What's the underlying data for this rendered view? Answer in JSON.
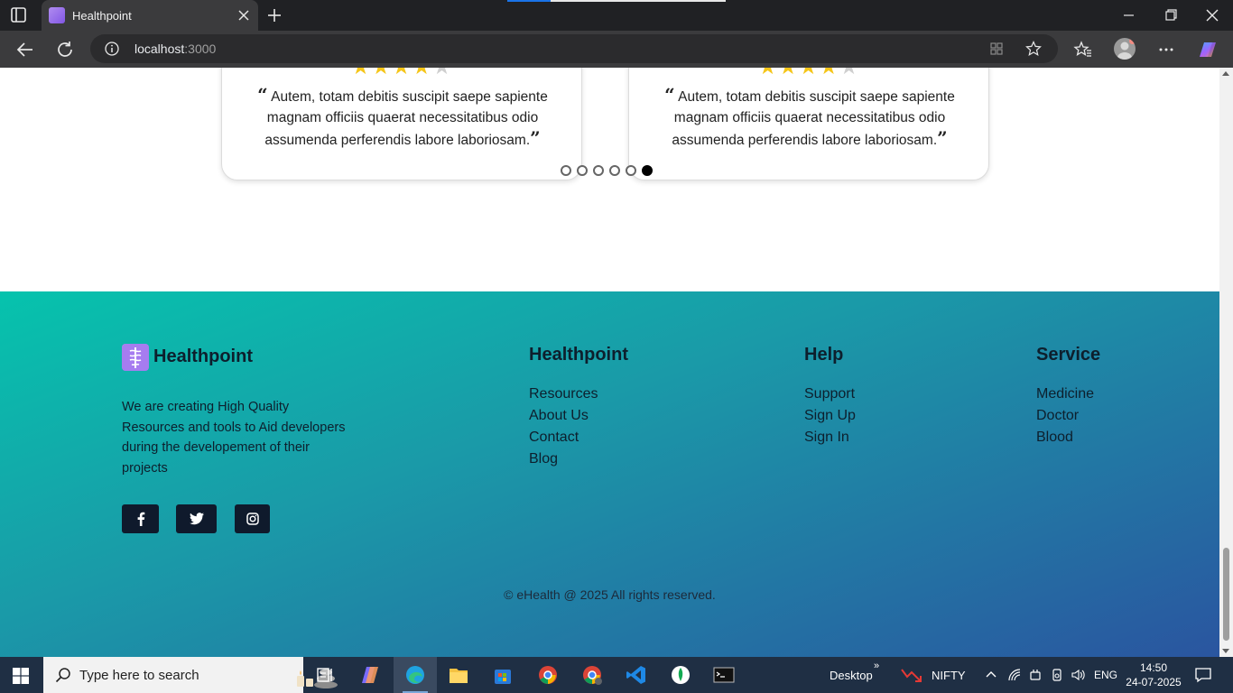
{
  "browser": {
    "tab_title": "Healthpoint",
    "url_host": "localhost",
    "url_port": ":3000"
  },
  "testimonials": [
    {
      "rating": 4,
      "quote": "Autem, totam debitis suscipit saepe sapiente magnam officiis quaerat necessitatibus odio assumenda perferendis labore laboriosam."
    },
    {
      "rating": 4,
      "quote": "Autem, totam debitis suscipit saepe sapiente magnam officiis quaerat necessitatibus odio assumenda perferendis labore laboriosam."
    }
  ],
  "carousel": {
    "dot_count": 6,
    "active_dot": 6
  },
  "footer": {
    "brand": "Healthpoint",
    "about": "We are creating High Quality Resources and tools to Aid developers during the developement of their projects",
    "social": [
      "facebook-icon",
      "twitter-icon",
      "instagram-icon"
    ],
    "columns": [
      {
        "title": "Healthpoint",
        "links": [
          "Resources",
          "About Us",
          "Contact",
          "Blog"
        ]
      },
      {
        "title": "Help",
        "links": [
          "Support",
          "Sign Up",
          "Sign In"
        ]
      },
      {
        "title": "Service",
        "links": [
          "Medicine",
          "Doctor",
          "Blood"
        ]
      }
    ],
    "copyright": "© eHealth @ 2025 All rights reserved."
  },
  "taskbar": {
    "search_placeholder": "Type here to search",
    "desktop_label": "Desktop",
    "ticker": "NIFTY",
    "language": "ENG",
    "time": "14:50",
    "date": "24-07-2025"
  },
  "colors": {
    "footer_gradient_start": "#06c3ad",
    "footer_gradient_end": "#2a55a0",
    "star_on": "#f5c518",
    "star_off": "#cfcfcf"
  }
}
